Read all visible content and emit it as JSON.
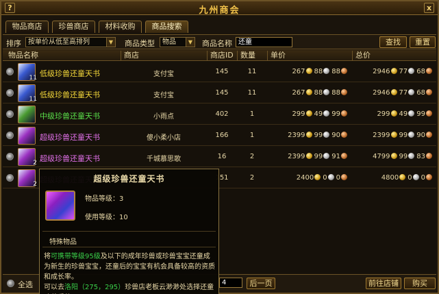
{
  "window": {
    "title": "九州商会",
    "help": "?",
    "close": "x"
  },
  "tabs": [
    {
      "label": "物品商店",
      "active": true
    },
    {
      "label": "珍兽商店",
      "active": false
    },
    {
      "label": "材料收购",
      "active": false
    },
    {
      "label": "商品搜索",
      "active": true
    }
  ],
  "filters": {
    "sort_label": "排序",
    "sort_value": "按单价从低至高排列",
    "type_label": "商品类型",
    "type_value": "物品",
    "name_label": "商品名称",
    "name_value": "还童",
    "search_button": "查找",
    "reset_button": "重置"
  },
  "columns": {
    "item_name": "物品名称",
    "shop": "商店",
    "shop_id": "商店ID",
    "quantity": "数量",
    "unit_price": "单价",
    "total_price": "总价"
  },
  "rows": [
    {
      "name": "低级珍兽还童天书",
      "name_color": "#f4d83a",
      "icon_color": "#3a5ad0",
      "badge": "11",
      "shop": "支付宝",
      "shop_id": "145",
      "qty": "11",
      "unit": [
        "267",
        "88",
        "88"
      ],
      "total": [
        "2946",
        "77",
        "68"
      ]
    },
    {
      "name": "低级珍兽还童天书",
      "name_color": "#f4d83a",
      "icon_color": "#3a5ad0",
      "badge": "11",
      "shop": "支付宝",
      "shop_id": "145",
      "qty": "11",
      "unit": [
        "267",
        "88",
        "88"
      ],
      "total": [
        "2946",
        "77",
        "68"
      ]
    },
    {
      "name": "中级珍兽还童天书",
      "name_color": "#5ae04a",
      "icon_color": "#4a9a30",
      "badge": "",
      "shop": "小雨点",
      "shop_id": "402",
      "qty": "1",
      "unit": [
        "299",
        "49",
        "99"
      ],
      "total": [
        "299",
        "49",
        "99"
      ]
    },
    {
      "name": "超级珍兽还童天书",
      "name_color": "#e070e8",
      "icon_color": "#9a30c0",
      "badge": "",
      "shop": "傻小柔小店",
      "shop_id": "166",
      "qty": "1",
      "unit": [
        "2399",
        "99",
        "90"
      ],
      "total": [
        "2399",
        "99",
        "90"
      ]
    },
    {
      "name": "超级珍兽还童天书",
      "name_color": "#e070e8",
      "icon_color": "#9a30c0",
      "badge": "2",
      "shop": "千城慕思歌",
      "shop_id": "16",
      "qty": "2",
      "unit": [
        "2399",
        "99",
        "91"
      ],
      "total": [
        "4799",
        "99",
        "83"
      ]
    },
    {
      "name": "超级珍兽还童天书",
      "name_color": "#e070e8",
      "icon_color": "#9a30c0",
      "badge": "2",
      "shop": "",
      "shop_id": "151",
      "qty": "2",
      "unit": [
        "2400",
        "0",
        "0"
      ],
      "total": [
        "4800",
        "0",
        "0"
      ]
    }
  ],
  "footer": {
    "select_all": "全选",
    "page_value": "4",
    "prev_page": "后一页",
    "goto_shop": "前往店铺",
    "buy": "购买"
  },
  "tooltip": {
    "title": "超级珍兽还童天书",
    "item_level": "物品等级：3",
    "use_level": "使用等级：10",
    "special": "特殊物品",
    "desc_1": "将",
    "desc_hl1": "可携带等级95级",
    "desc_2": "及以下的成年珍兽或珍兽宝宝还童成为新生的珍兽宝宝，还童后的宝宝有机会具备较高的资质和成长率。",
    "desc_3": "可以去",
    "desc_hl2": "洛阳（275，295）",
    "desc_4": "珍兽店老板云渺渺处选择还童珍兽后使用。"
  }
}
